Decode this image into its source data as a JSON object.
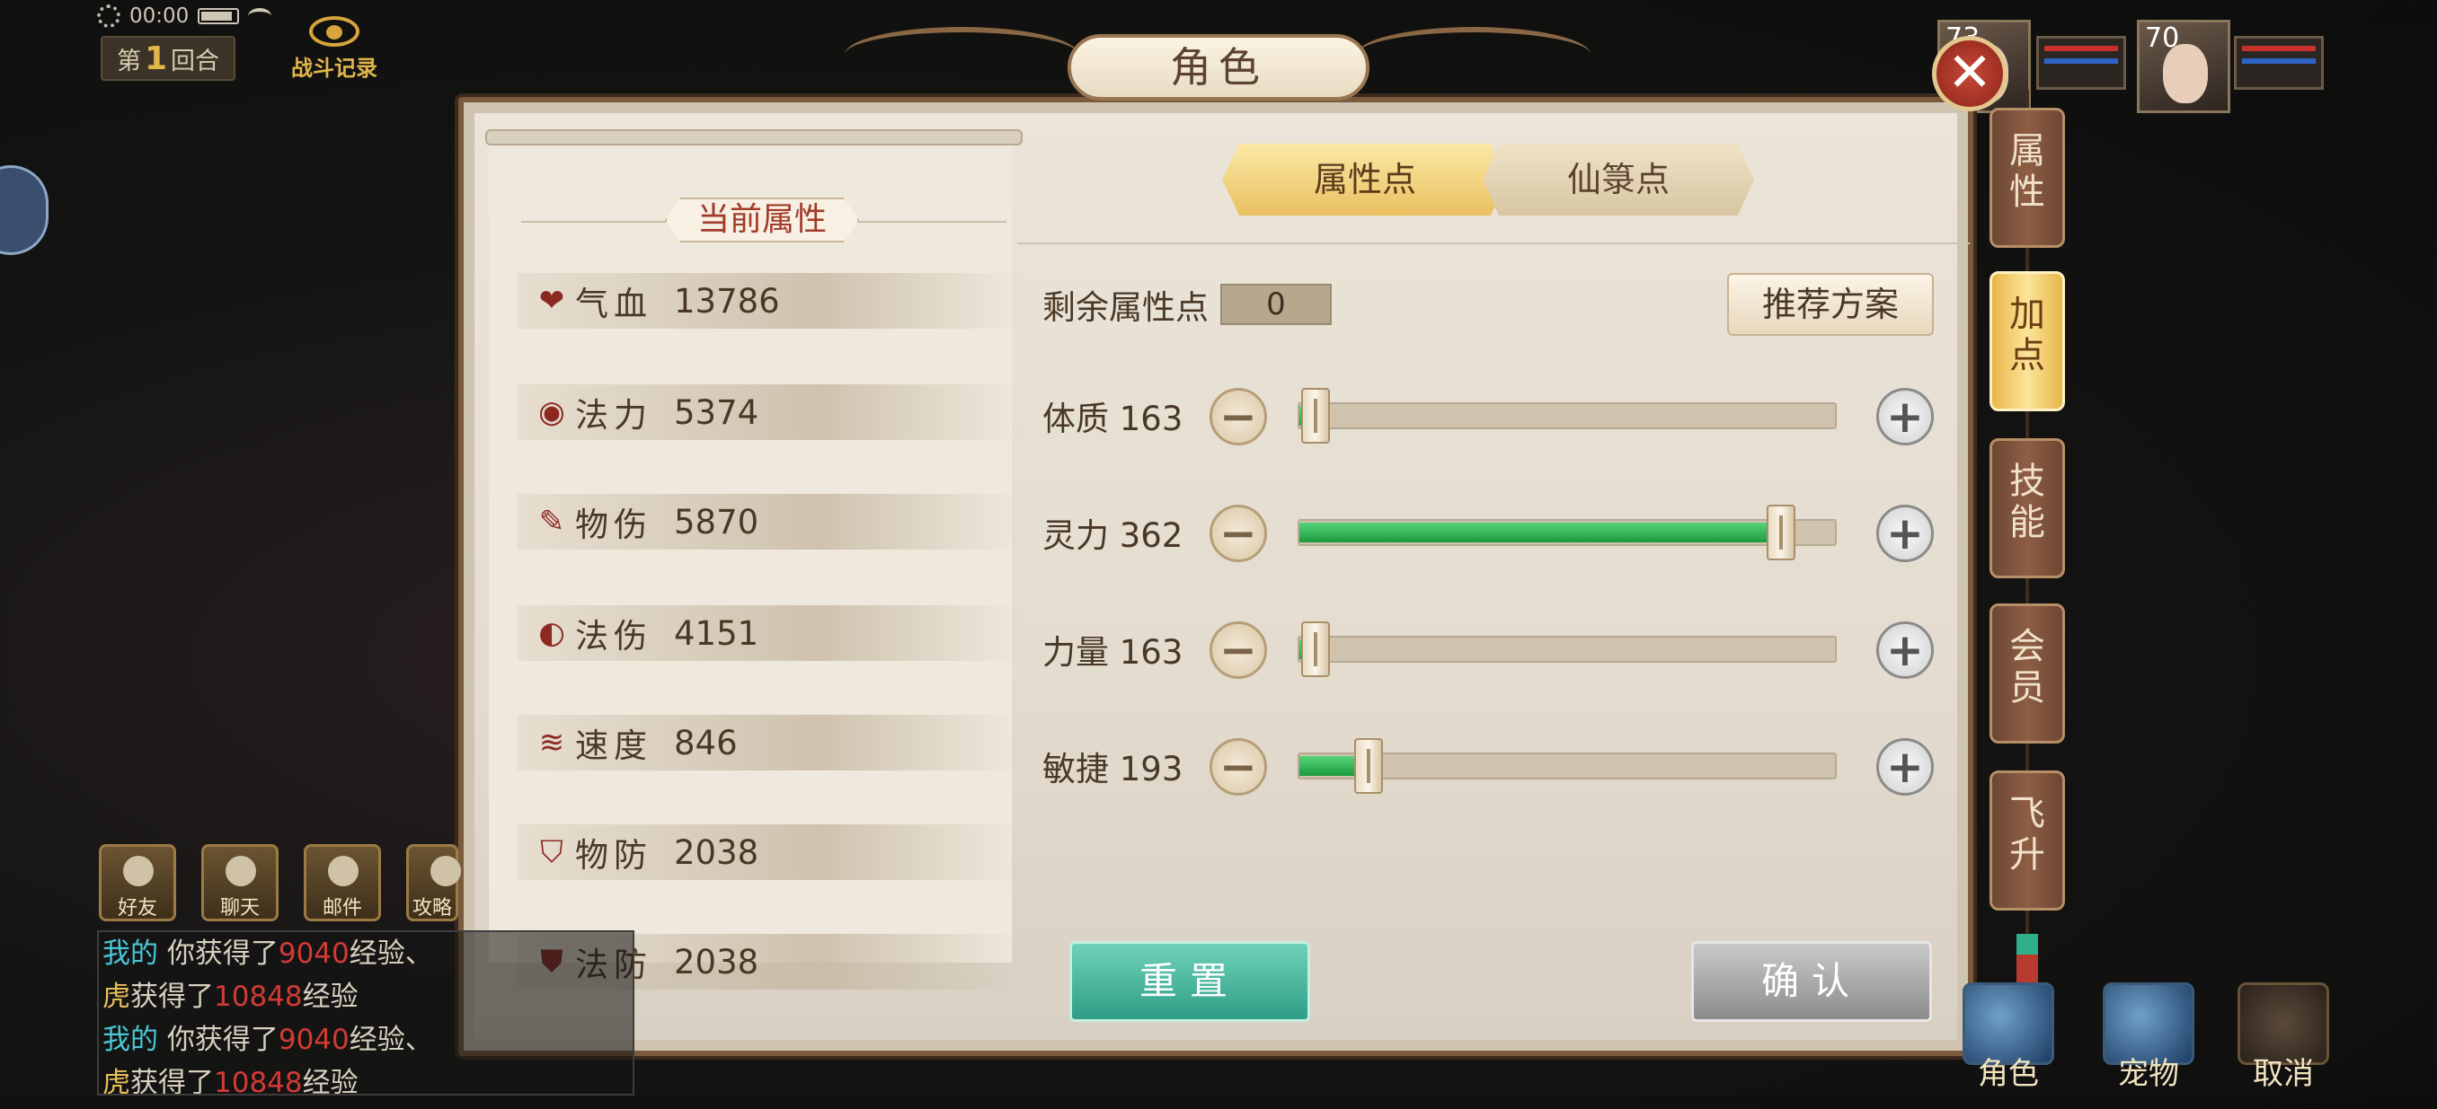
{
  "status_bar": {
    "time": "00:00"
  },
  "hud": {
    "round_prefix": "第",
    "round_number": "1",
    "round_suffix": "回合",
    "battle_log": "战斗记录"
  },
  "portraits": [
    {
      "level": "73"
    },
    {
      "level": "70"
    }
  ],
  "dialog": {
    "title": "角色",
    "current_attributes_title": "当前属性",
    "attributes": [
      {
        "icon": "heart-icon",
        "name": "气血",
        "value": "13786"
      },
      {
        "icon": "mana-swirl-icon",
        "name": "法力",
        "value": "5374"
      },
      {
        "icon": "claw-icon",
        "name": "物伤",
        "value": "5870"
      },
      {
        "icon": "flame-swirl-icon",
        "name": "法伤",
        "value": "4151"
      },
      {
        "icon": "wind-icon",
        "name": "速度",
        "value": "846"
      },
      {
        "icon": "shield-icon",
        "name": "物防",
        "value": "2038"
      },
      {
        "icon": "magic-shield-icon",
        "name": "法防",
        "value": "2038"
      }
    ],
    "tabs": [
      {
        "label": "属性点",
        "active": true
      },
      {
        "label": "仙箓点",
        "active": false
      }
    ],
    "remaining_label": "剩余属性点",
    "remaining_value": "0",
    "recommend_button": "推荐方案",
    "stats": [
      {
        "label": "体质 163",
        "fill_fraction": 0.03
      },
      {
        "label": "灵力 362",
        "fill_fraction": 0.9
      },
      {
        "label": "力量 163",
        "fill_fraction": 0.03
      },
      {
        "label": "敏捷 193",
        "fill_fraction": 0.13
      }
    ],
    "reset_button": "重置",
    "confirm_button": "确认"
  },
  "side_tabs": [
    {
      "label": "属性",
      "active": false
    },
    {
      "label": "加点",
      "active": true
    },
    {
      "label": "技能",
      "active": false
    },
    {
      "label": "会员",
      "active": false
    },
    {
      "label": "飞升",
      "active": false
    }
  ],
  "social": [
    "好友",
    "聊天",
    "邮件",
    "攻略"
  ],
  "chat": [
    {
      "speaker": "我的",
      "pre": " 你获得了",
      "num": "9040",
      "post": "经验、"
    },
    {
      "speaker": "虎",
      "pre": "获得了",
      "num": "10848",
      "post": "经验"
    },
    {
      "speaker": "我的",
      "pre": " 你获得了",
      "num": "9040",
      "post": "经验、"
    },
    {
      "speaker": "虎",
      "pre": "获得了",
      "num": "10848",
      "post": "经验"
    }
  ],
  "commands": [
    "角色",
    "宠物",
    "取消"
  ],
  "colors": {
    "accent_gold": "#e9c060",
    "slider_green": "#1c9a3e",
    "reset_teal": "#2e9e86"
  }
}
